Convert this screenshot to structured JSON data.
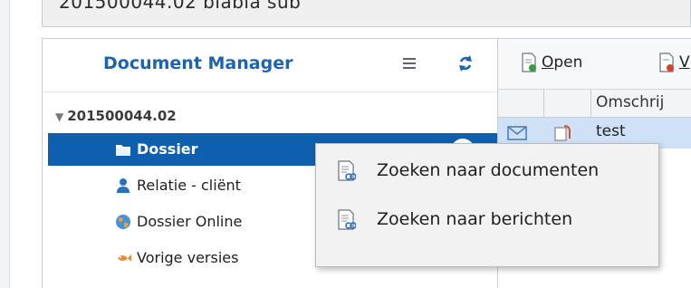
{
  "top_title": "201500044.02 blabla sub",
  "doc_manager": {
    "title": "Document Manager",
    "menu_icon": "hamburger-icon",
    "refresh_icon": "refresh-icon"
  },
  "tree": {
    "root_label": "201500044.02",
    "items": [
      {
        "label": "Dossier",
        "icon": "folder-icon",
        "badge": "1",
        "selected": true
      },
      {
        "label": "Relatie - cliënt",
        "icon": "person-icon"
      },
      {
        "label": "Dossier Online",
        "icon": "globe-icon"
      },
      {
        "label": "Vorige versies",
        "icon": "fish-icon"
      }
    ]
  },
  "toolbar": {
    "open_label_first": "O",
    "open_label_rest": "pen",
    "next_label": "V"
  },
  "grid": {
    "column_header": "Omschrij",
    "row_text": "test"
  },
  "context_menu": {
    "items": [
      {
        "label": "Zoeken naar documenten"
      },
      {
        "label": "Zoeken naar berichten"
      }
    ]
  },
  "colors": {
    "accent": "#1c63b0",
    "selected": "#0e5fae",
    "row_highlight": "#cfe1f6"
  }
}
